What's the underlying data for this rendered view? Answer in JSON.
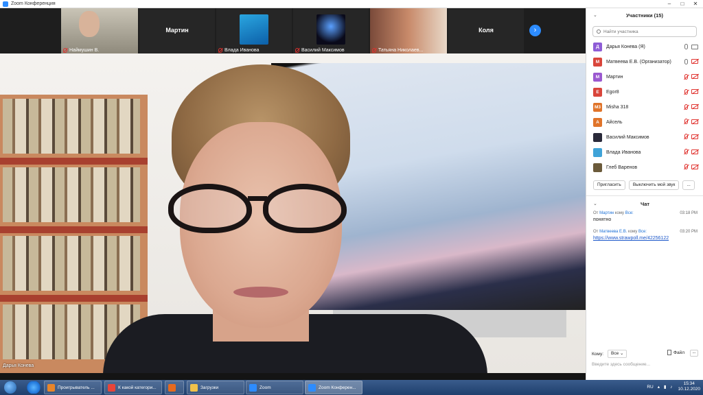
{
  "window": {
    "title": "Zoom Конференция"
  },
  "thumbnails": [
    {
      "name": "Наймушин В.",
      "label": ""
    },
    {
      "name": "",
      "label": "Мартин"
    },
    {
      "name": "Влада Иванова",
      "label": ""
    },
    {
      "name": "Василий Максимов",
      "label": ""
    },
    {
      "name": "Татьяна Николаев...",
      "label": ""
    },
    {
      "name": "",
      "label": "Коля"
    }
  ],
  "main_speaker": {
    "name": "Дарья Конева"
  },
  "participants": {
    "title": "Участники (15)",
    "search_placeholder": "Найти участника",
    "items": [
      {
        "initials": "Д",
        "name": "Дарья Конева (Я)",
        "color": "#8e5dd6",
        "mic": "on",
        "cam": "on"
      },
      {
        "initials": "М",
        "name": "Матвеева Е.В. (Организатор)",
        "color": "#d9453b",
        "mic": "on",
        "cam": "off"
      },
      {
        "initials": "М",
        "name": "Мартин",
        "color": "#9b59d0",
        "mic": "off",
        "cam": "off"
      },
      {
        "initials": "E",
        "name": "Egor8",
        "color": "#d9453b",
        "mic": "off",
        "cam": "off"
      },
      {
        "initials": "M3",
        "name": "Misha 318",
        "color": "#e0742a",
        "mic": "off",
        "cam": "off"
      },
      {
        "initials": "А",
        "name": "Айсель",
        "color": "#e0742a",
        "mic": "off",
        "cam": "off"
      },
      {
        "initials": "",
        "name": "Василий Максимов",
        "color": "#2a2a3a",
        "mic": "off",
        "cam": "off"
      },
      {
        "initials": "",
        "name": "Влада Иванова",
        "color": "#3fa3d8",
        "mic": "off",
        "cam": "off"
      },
      {
        "initials": "",
        "name": "Глеб Варенов",
        "color": "#6b5a3a",
        "mic": "off",
        "cam": "off"
      }
    ],
    "invite_label": "Пригласить",
    "mute_label": "Выключить мой звук",
    "more_label": "..."
  },
  "chat": {
    "title": "Чат",
    "messages": [
      {
        "from_prefix": "От",
        "from": "Мартин",
        "to_prefix": "кому",
        "to": "Все:",
        "time": "03:18 PM",
        "text": "понятно",
        "is_link": false
      },
      {
        "from_prefix": "От",
        "from": "Матвеева Е.В.",
        "to_prefix": "кому",
        "to": "Все:",
        "time": "03:20 PM",
        "text": "https://www.strawpoll.me/42256122",
        "is_link": true
      }
    ],
    "to_label": "Кому:",
    "to_value": "Все",
    "file_label": "Файл",
    "more_label": "...",
    "input_placeholder": "Введите здесь сообщение..."
  },
  "taskbar": {
    "tasks": [
      {
        "label": "Проигрыватель ...",
        "color": "#e8852a",
        "active": false
      },
      {
        "label": "К какой категори...",
        "color": "#e7453a",
        "active": false
      },
      {
        "label": "",
        "color": "#e66a1f",
        "active": false
      },
      {
        "label": "Загрузки",
        "color": "#f1c24a",
        "active": false
      },
      {
        "label": "Zoom",
        "color": "#2d8cff",
        "active": false
      },
      {
        "label": "Zoom Конферен...",
        "color": "#2d8cff",
        "active": true
      }
    ],
    "lang": "RU",
    "time": "15:34",
    "date": "10.12.2020"
  }
}
